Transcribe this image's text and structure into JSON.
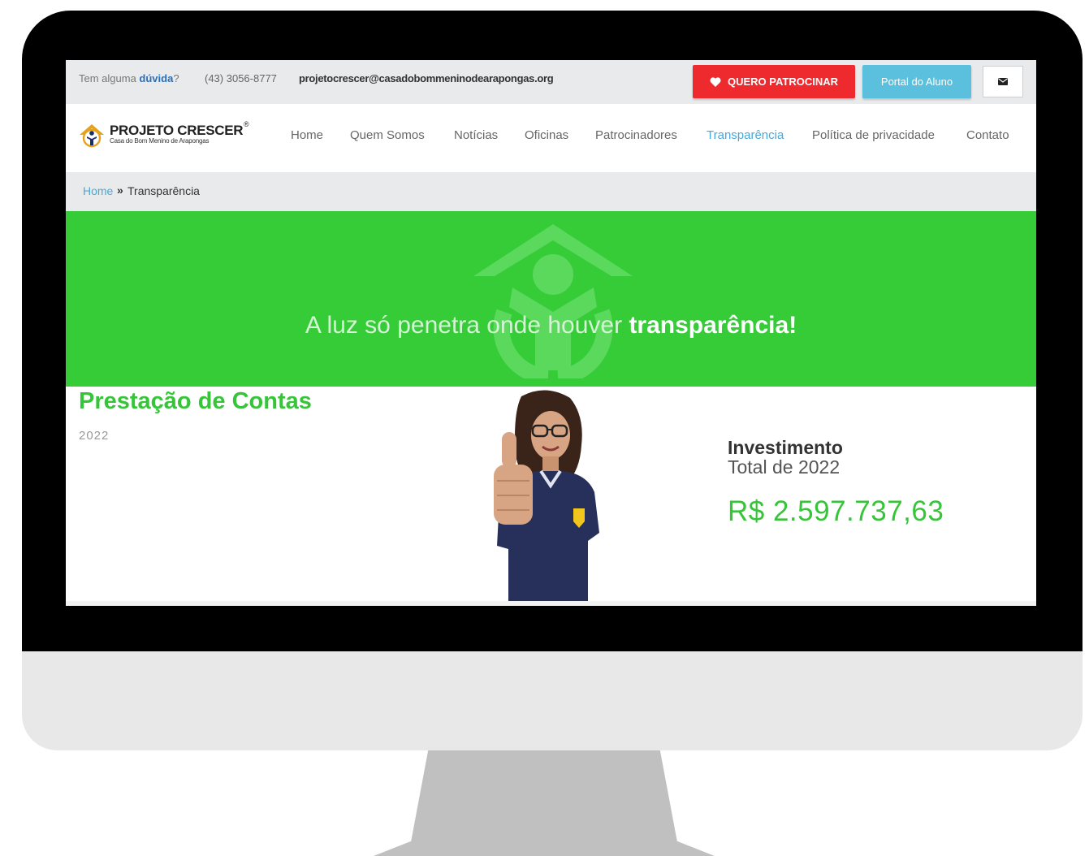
{
  "topbar": {
    "help_prefix": "Tem alguma ",
    "help_link": "dúvida",
    "help_suffix": "?",
    "phone": "(43) 3056-8777",
    "email": "projetocrescer@casadobommeninodearapongas.org",
    "patrocinar_label": "QUERO PATROCINAR",
    "aluno_label": "Portal do Aluno"
  },
  "logo": {
    "name": "PROJETO CRESCER",
    "reg": "®",
    "subtitle": "Casa do Bom Menino de Arapongas"
  },
  "nav": {
    "items": [
      "Home",
      "Quem Somos",
      "Notícias",
      "Oficinas",
      "Patrocinadores",
      "Transparência",
      "Política de privacidade",
      "Contato"
    ],
    "active": "Transparência"
  },
  "breadcrumb": {
    "home": "Home",
    "separator": "»",
    "current": "Transparência"
  },
  "banner": {
    "text_light": "A luz só penetra onde houver ",
    "text_bold": "transparência!",
    "background": "#35cc37"
  },
  "content": {
    "title": "Prestação de Contas",
    "year": "2022",
    "invest_label": "Investimento",
    "invest_sub": "Total de 2022",
    "invest_value": "R$ 2.597.737,63"
  },
  "colors": {
    "accent_green": "#36c538",
    "patrocinar_red": "#ee2a2f",
    "aluno_blue": "#5bc0de",
    "link_blue": "#4aa8d8"
  },
  "icons": [
    "heart-icon",
    "envelope-icon",
    "house-child-icon"
  ]
}
